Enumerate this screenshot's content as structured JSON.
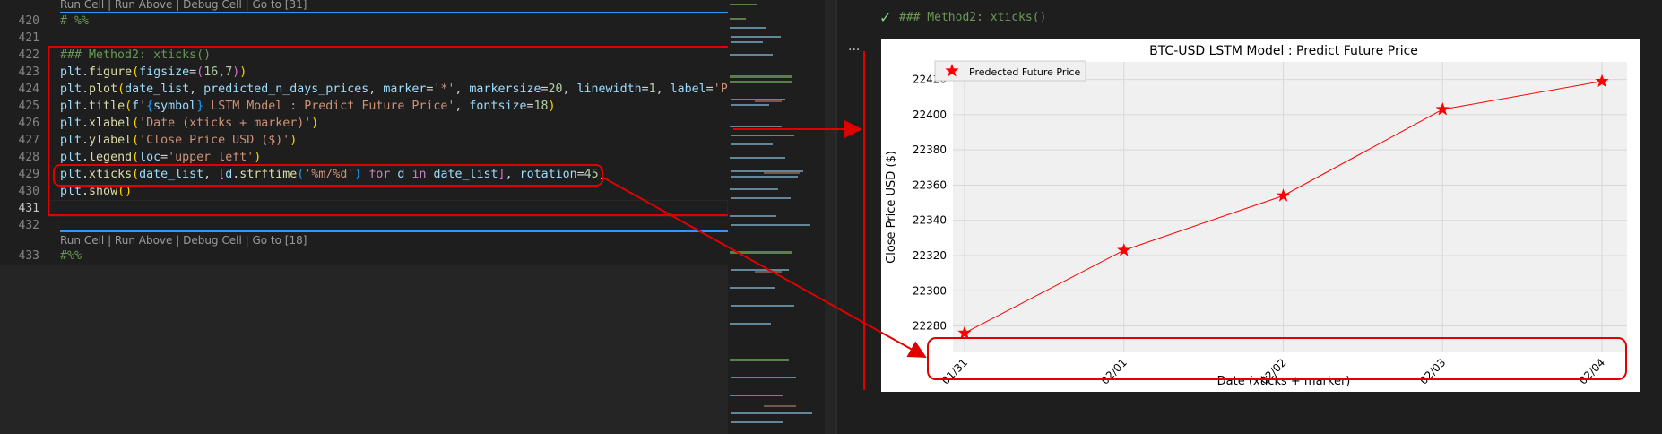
{
  "editor": {
    "lens_top": "Run Cell | Run Above | Debug Cell | Go to [31]",
    "lens_bottom": "Run Cell | Run Above | Debug Cell | Go to [18]",
    "line_numbers": [
      "420",
      "421",
      "422",
      "423",
      "424",
      "425",
      "426",
      "427",
      "428",
      "429",
      "430",
      "431",
      "432",
      "433"
    ],
    "lines": {
      "l420": "# %%",
      "l422": "### Method2: xticks()",
      "l433": "#%%"
    }
  },
  "output": {
    "cell_title": "### Method2: xticks()",
    "more": "..."
  },
  "colors": {
    "accent_red": "#e00000",
    "series_red": "#ff0000",
    "lens_blue": "#3794ff"
  },
  "icons": [
    "check-icon",
    "more-actions-icon"
  ],
  "chart_data": {
    "type": "line",
    "title": "BTC-USD LSTM Model : Predict Future Price",
    "xlabel": "Date (xticks + marker)",
    "ylabel": "Close Price USD ($)",
    "categories": [
      "01/31",
      "02/01",
      "02/02",
      "02/03",
      "02/04"
    ],
    "series": [
      {
        "name": "Predected Future Price",
        "values": [
          22276,
          22323,
          22354,
          22403,
          22419
        ],
        "marker": "*",
        "color": "#ff0000"
      }
    ],
    "ylim": [
      22265,
      22430
    ],
    "yticks": [
      22280,
      22300,
      22320,
      22340,
      22360,
      22380,
      22400,
      22420
    ],
    "grid": true,
    "legend": "upper left"
  }
}
